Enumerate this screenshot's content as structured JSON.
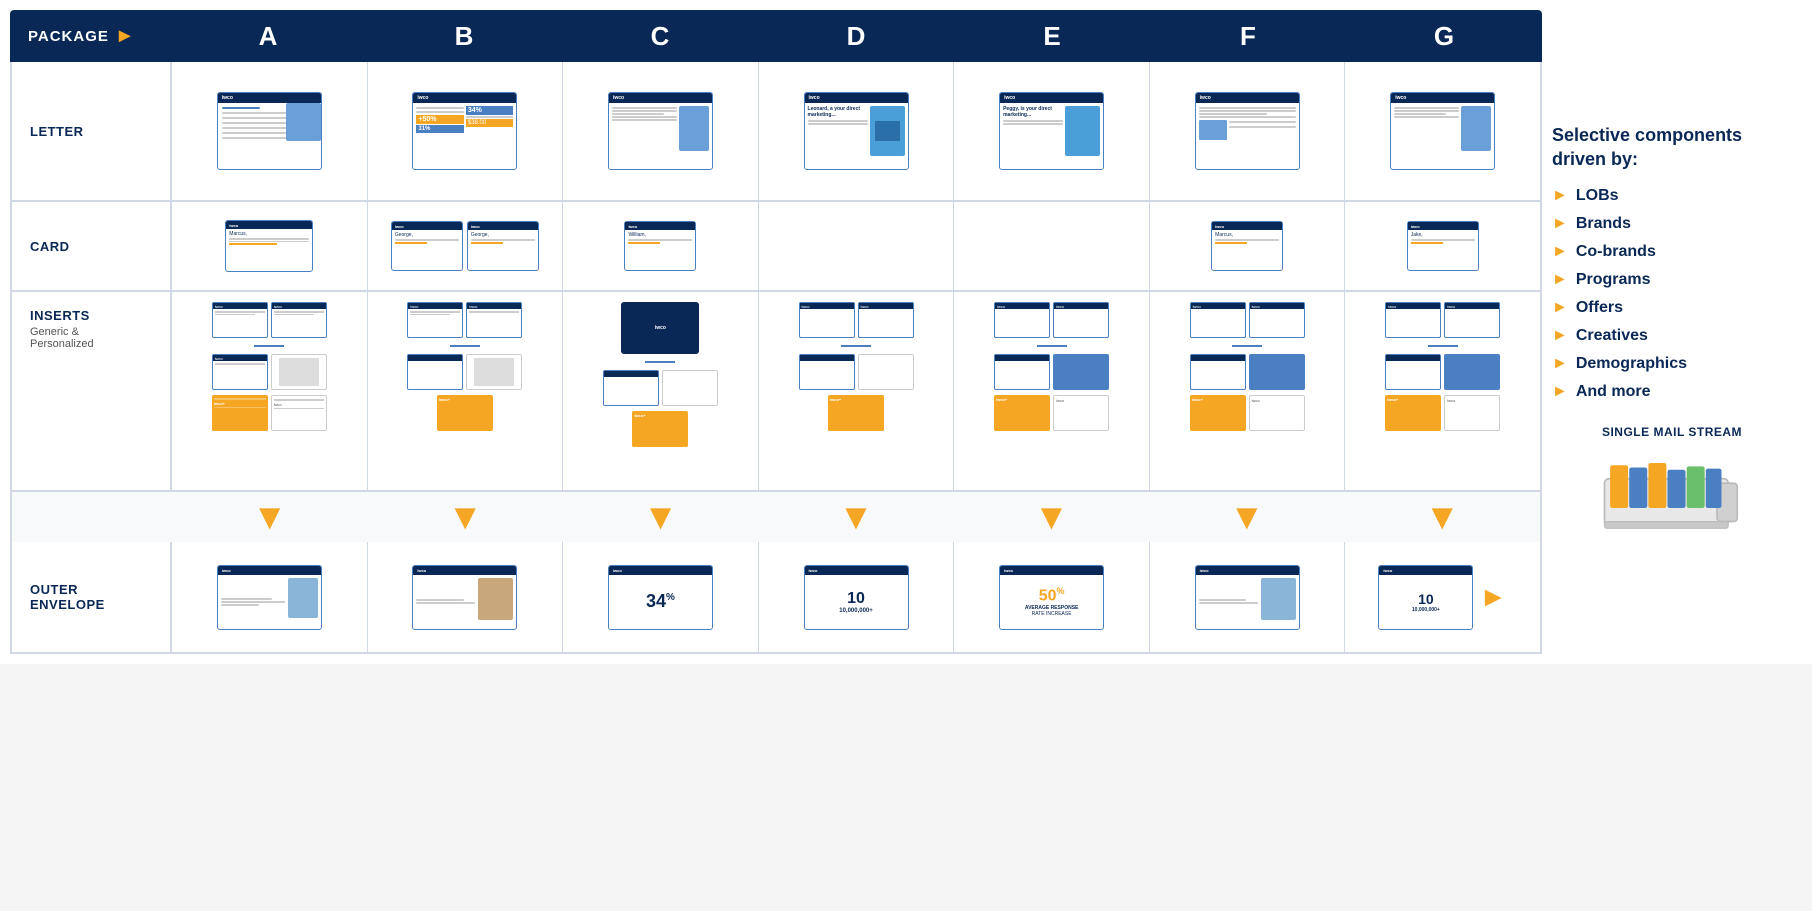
{
  "header": {
    "package_label": "PACKAGE",
    "columns": [
      "A",
      "B",
      "C",
      "D",
      "E",
      "F",
      "G"
    ]
  },
  "rows": {
    "letter": {
      "label": "LETTER"
    },
    "card": {
      "label": "CARD"
    },
    "inserts": {
      "label": "INSERTS",
      "sublabel": "Generic &\nPersonalized"
    },
    "outer_envelope": {
      "label_line1": "OUTER",
      "label_line2": "ENVELOPE"
    }
  },
  "sidebar": {
    "title": "Selective components driven by:",
    "items": [
      {
        "label": "LOBs"
      },
      {
        "label": "Brands"
      },
      {
        "label": "Co-brands"
      },
      {
        "label": "Programs"
      },
      {
        "label": "Offers"
      },
      {
        "label": "Creatives"
      },
      {
        "label": "Demographics"
      },
      {
        "label": "And more"
      }
    ],
    "single_mail_stream": "SINGLE MAIL STREAM"
  },
  "envelope_numbers": {
    "c": "34%",
    "d": "10\n10,000,000+",
    "e": "50%",
    "g": "10\n10,000,000+"
  }
}
